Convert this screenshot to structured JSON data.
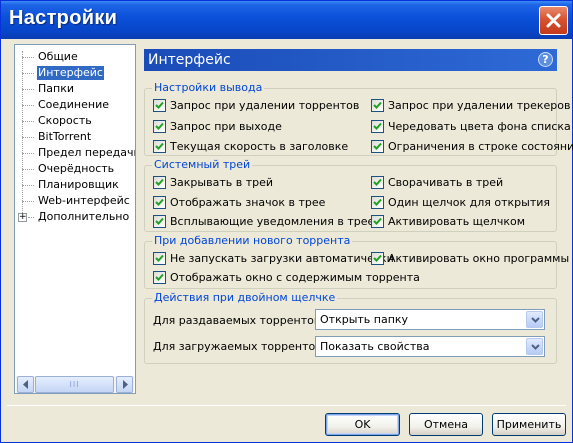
{
  "window": {
    "title": "Настройки",
    "accent_color": "#0a50d8",
    "close_icon": "close-icon"
  },
  "sidebar": {
    "items": [
      {
        "label": "Общие",
        "selected": false
      },
      {
        "label": "Интерфейс",
        "selected": true
      },
      {
        "label": "Папки",
        "selected": false
      },
      {
        "label": "Соединение",
        "selected": false
      },
      {
        "label": "Скорость",
        "selected": false
      },
      {
        "label": "BitTorrent",
        "selected": false
      },
      {
        "label": "Предел передачи",
        "selected": false
      },
      {
        "label": "Очерёдность",
        "selected": false
      },
      {
        "label": "Планировщик",
        "selected": false
      },
      {
        "label": "Web-интерфейс",
        "selected": false
      },
      {
        "label": "Дополнительно",
        "selected": false,
        "expandable": true
      }
    ],
    "scroll_thumb_grip": "III"
  },
  "panel": {
    "title": "Интерфейс",
    "help_label": "?"
  },
  "groups": {
    "output": {
      "title": "Настройки вывода",
      "items": [
        {
          "label": "Запрос при удалении торрентов",
          "checked": true
        },
        {
          "label": "Запрос при удалении трекеров",
          "checked": true
        },
        {
          "label": "Запрос при выходе",
          "checked": true
        },
        {
          "label": "Чередовать цвета фона списка",
          "checked": true
        },
        {
          "label": "Текущая скорость в заголовке",
          "checked": true
        },
        {
          "label": "Ограничения в строке состояния",
          "checked": true
        }
      ]
    },
    "tray": {
      "title": "Системный трей",
      "items": [
        {
          "label": "Закрывать в трей",
          "checked": true
        },
        {
          "label": "Сворачивать в трей",
          "checked": true
        },
        {
          "label": "Отображать значок в трее",
          "checked": true
        },
        {
          "label": "Один щелчок для открытия",
          "checked": true
        },
        {
          "label": "Всплывающие уведомления в трее",
          "checked": true
        },
        {
          "label": "Активировать щелчком",
          "checked": true
        }
      ]
    },
    "new_torrent": {
      "title": "При добавлении нового торрента",
      "items": [
        {
          "label": "Не запускать загрузки автоматически",
          "checked": true
        },
        {
          "label": "Активировать окно программы",
          "checked": true
        },
        {
          "label": "Отображать окно с содержимым торрента",
          "checked": true
        }
      ]
    },
    "double_click": {
      "title": "Действия при двойном щелчке",
      "seeding_label": "Для раздаваемых торрентов:",
      "seeding_value": "Открыть папку",
      "downloading_label": "Для загружаемых торрентов:",
      "downloading_value": "Показать свойства"
    }
  },
  "buttons": {
    "ok": "OK",
    "cancel": "Отмена",
    "apply": "Применить"
  }
}
